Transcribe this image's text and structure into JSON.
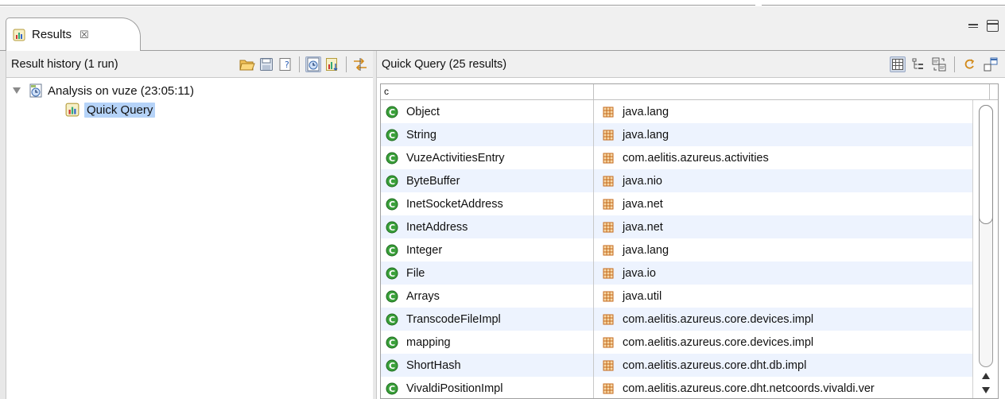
{
  "tab": {
    "label": "Results",
    "close_glyph": "☒"
  },
  "left": {
    "title": "Result history (1 run)",
    "tree": {
      "run_label": "Analysis on vuze (23:05:11)",
      "query_label": "Quick Query"
    }
  },
  "right": {
    "title": "Quick Query (25 results)",
    "columns": [
      "c",
      "",
      ""
    ],
    "rows": [
      {
        "name": "Object",
        "package": "java.lang"
      },
      {
        "name": "String",
        "package": "java.lang"
      },
      {
        "name": "VuzeActivitiesEntry",
        "package": "com.aelitis.azureus.activities"
      },
      {
        "name": "ByteBuffer",
        "package": "java.nio"
      },
      {
        "name": "InetSocketAddress",
        "package": "java.net"
      },
      {
        "name": "InetAddress",
        "package": "java.net"
      },
      {
        "name": "Integer",
        "package": "java.lang"
      },
      {
        "name": "File",
        "package": "java.io"
      },
      {
        "name": "Arrays",
        "package": "java.util"
      },
      {
        "name": "TranscodeFileImpl",
        "package": "com.aelitis.azureus.core.devices.impl"
      },
      {
        "name": "mapping",
        "package": "com.aelitis.azureus.core.devices.impl"
      },
      {
        "name": "ShortHash",
        "package": "com.aelitis.azureus.core.dht.db.impl"
      },
      {
        "name": "VivaldiPositionImpl",
        "package": "com.aelitis.azureus.core.dht.netcoords.vivaldi.ver"
      }
    ]
  },
  "icons": {
    "results_tab": "results-view-icon",
    "class_icon_color": "#3aa03a",
    "package_icon_color": "#c46a1e",
    "selection_color": "#b5d3f8",
    "alt_row_color": "#edf3fe"
  }
}
